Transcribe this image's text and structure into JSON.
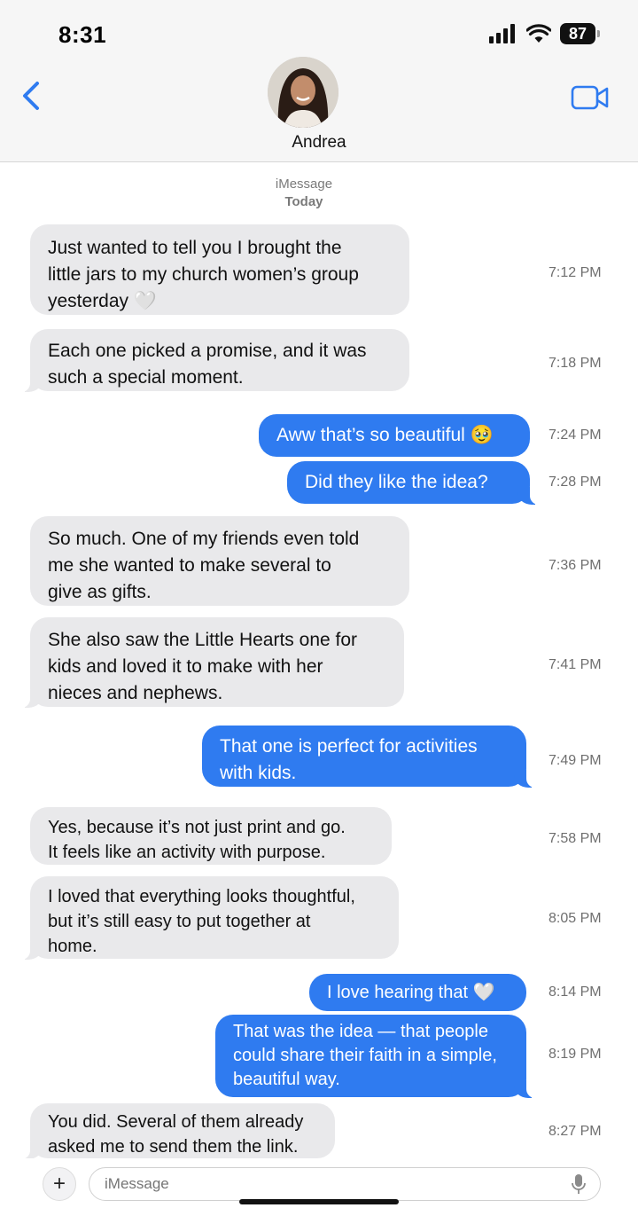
{
  "status_bar": {
    "time": "8:31",
    "battery": "87"
  },
  "contact": {
    "name": "Andrea"
  },
  "thread": {
    "service": "iMessage",
    "day": "Today"
  },
  "colors": {
    "outgoing": "#2f7bf0",
    "incoming": "#e9e9eb",
    "accent": "#2f7bf0"
  },
  "messages": [
    {
      "from": "them",
      "lines": [
        "Just wanted to tell you I brought the",
        "little jars to my church women’s group",
        "yesterday 🤍"
      ],
      "time": "7:12 PM"
    },
    {
      "from": "them",
      "lines": [
        "Each one picked a promise, and it was",
        "such a special moment."
      ],
      "time": "7:18 PM"
    },
    {
      "from": "me",
      "lines": [
        "Aww that’s so beautiful 🥹"
      ],
      "time": "7:24 PM"
    },
    {
      "from": "me",
      "lines": [
        "Did they like the idea?"
      ],
      "time": "7:28 PM"
    },
    {
      "from": "them",
      "lines": [
        "So much. One of my friends even told",
        "me she wanted to make several to",
        "give as gifts."
      ],
      "time": "7:36 PM"
    },
    {
      "from": "them",
      "lines": [
        "She also saw the Little Hearts one for",
        "kids and loved it to make with her",
        "nieces and nephews."
      ],
      "time": "7:41 PM"
    },
    {
      "from": "me",
      "lines": [
        "That one is perfect for activities",
        "with kids."
      ],
      "time": "7:49 PM"
    },
    {
      "from": "them",
      "lines": [
        "Yes, because it’s not just print and go.",
        "It feels like an activity with purpose."
      ],
      "time": "7:58 PM"
    },
    {
      "from": "them",
      "lines": [
        "I loved that everything looks thoughtful,",
        "but it’s still easy to put together at",
        "home."
      ],
      "time": "8:05 PM"
    },
    {
      "from": "me",
      "lines": [
        "I love hearing that 🤍"
      ],
      "time": "8:14 PM"
    },
    {
      "from": "me",
      "lines": [
        "That was the idea — that people",
        "could share their faith in a simple,",
        "beautiful way."
      ],
      "time": "8:19 PM"
    },
    {
      "from": "them",
      "lines": [
        "You did. Several of them already",
        "asked me to send them the link."
      ],
      "time": "8:27 PM"
    }
  ],
  "composer": {
    "placeholder": "iMessage",
    "plus_label": "+"
  },
  "icons": {
    "back": "chevron-left-icon",
    "video": "video-camera-icon",
    "mic": "microphone-icon",
    "signal": "cellular-signal-icon",
    "wifi": "wifi-icon"
  }
}
